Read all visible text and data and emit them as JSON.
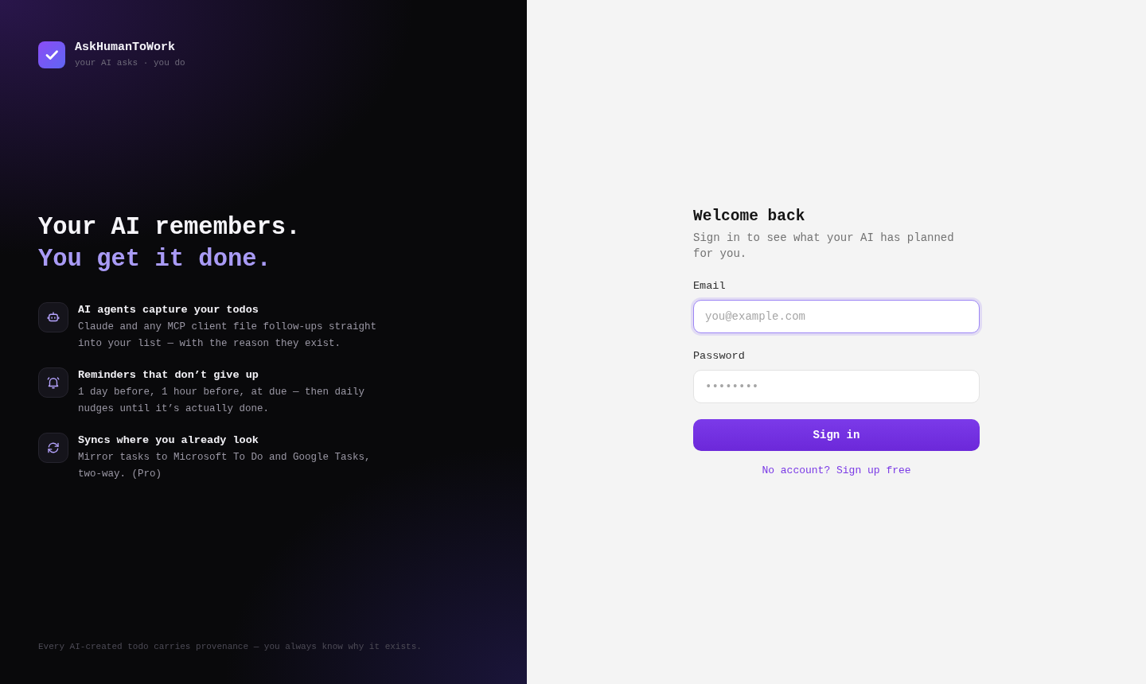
{
  "brand": {
    "name": "AskHumanToWork",
    "tagline": "your AI asks · you do"
  },
  "headline": {
    "line_1": "Your AI remembers.",
    "line_2": "You get it done."
  },
  "features": [
    {
      "title": "AI agents capture your todos",
      "description": "Claude and any MCP client file follow-ups straight into your list — with the reason they exist."
    },
    {
      "title": "Reminders that don’t give up",
      "description": "1 day before, 1 hour before, at due — then daily nudges until it’s actually done."
    },
    {
      "title": "Syncs where you already look",
      "description": "Mirror tasks to Microsoft To Do and Google Tasks, two-way. (Pro)"
    }
  ],
  "footer_note": "Every AI-created todo carries provenance — you always know why it exists.",
  "sign_in": {
    "title": "Welcome back",
    "subtitle": "Sign in to see what your AI has planned for you.",
    "fields": [
      {
        "label": "Email",
        "placeholder": "you@example.com",
        "focused": true
      },
      {
        "label": "Password",
        "placeholder": "••••••••",
        "focused": false
      }
    ],
    "submit_button": "Sign in",
    "signup_link": "No account? Sign up free"
  }
}
